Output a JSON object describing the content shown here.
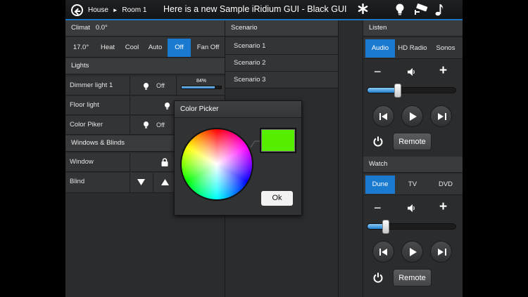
{
  "header": {
    "breadcrumb_home": "House",
    "breadcrumb_arrow": "►",
    "breadcrumb_room": "Room 1",
    "title": "Here is a new Sample iRidium GUI - Black GUI",
    "icons": [
      "back-arrow-icon",
      "asterisk-icon",
      "lightbulb-icon",
      "security-camera-icon",
      "music-note-icon"
    ]
  },
  "climate": {
    "header": "Climat",
    "header_value": "0.0°",
    "setpoint": "17.0°",
    "modes": [
      "Heat",
      "Cool",
      "Auto",
      "Off",
      "Fan Off"
    ],
    "active_mode": "Off"
  },
  "lights": {
    "header": "Lights",
    "items": [
      {
        "label": "Dimmer light 1",
        "state": "Off",
        "level_label": "84%",
        "level": 0.84
      },
      {
        "label": "Floor light",
        "state": ""
      },
      {
        "label": "Color Piker",
        "state": "Off"
      }
    ]
  },
  "blinds": {
    "header": "Windows & Blinds",
    "items": [
      {
        "label": "Window",
        "icon": "lock-icon"
      },
      {
        "label": "Blind",
        "icons": [
          "triangle-down-icon",
          "triangle-up-icon"
        ]
      }
    ]
  },
  "scenario": {
    "header": "Scenario",
    "items": [
      "Scenario 1",
      "Scenario 2",
      "Scenario 3"
    ]
  },
  "color_picker": {
    "title": "Color Picker",
    "selected_color": "#55ee00",
    "ok_label": "Ok"
  },
  "listen": {
    "header": "Listen",
    "tabs": [
      "Audio",
      "HD Radio",
      "Sonos"
    ],
    "active_tab": "Audio",
    "volume_minus": "−",
    "volume_plus": "+",
    "volume": 0.38,
    "remote_label": "Remote"
  },
  "watch": {
    "header": "Watch",
    "tabs": [
      "Dune",
      "TV",
      "DVD"
    ],
    "active_tab": "Dune",
    "volume_minus": "−",
    "volume_plus": "+",
    "volume": 0.22,
    "remote_label": "Remote"
  },
  "colors": {
    "accent": "#1a7ad0",
    "background": "#2b2c2e",
    "picker_swatch": "#55ee00"
  }
}
